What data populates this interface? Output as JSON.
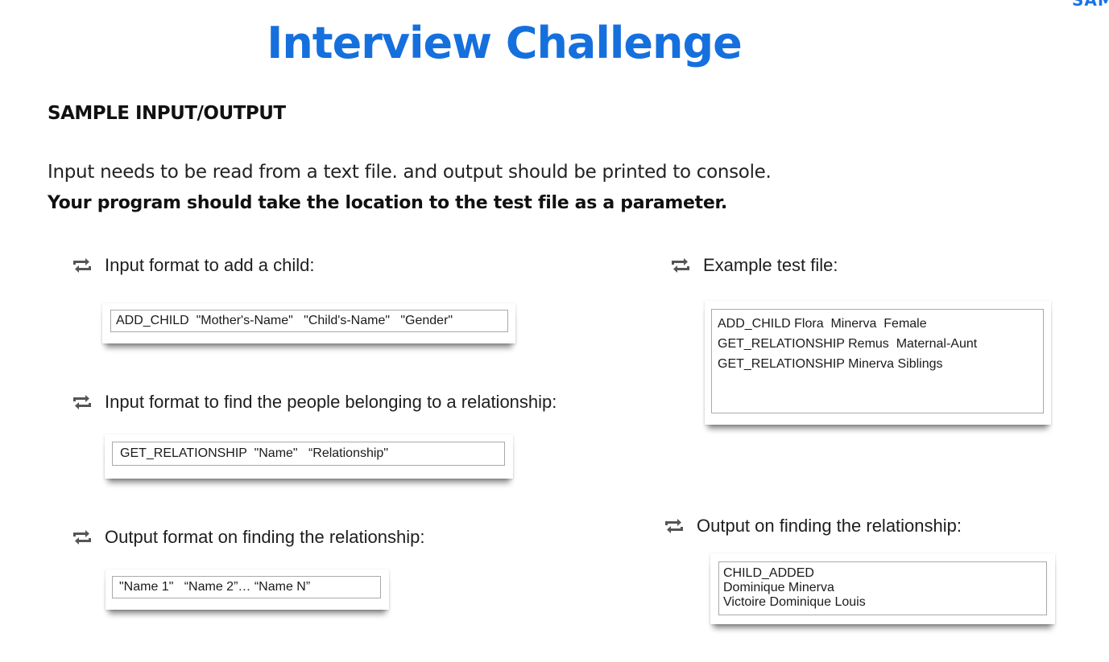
{
  "page": {
    "corner_mark": "SAMPLE",
    "title": "Interview Challenge",
    "section_heading": "SAMPLE INPUT/OUTPUT",
    "intro": "Input needs to be read from a text file. and output should be printed to console.",
    "intro_bold": "Your program should take the location to the test file as a parameter."
  },
  "icon": "retweet-icon",
  "left_blocks": [
    {
      "label": "Input format to add a child:",
      "code": [
        "ADD_CHILD  \"Mother's-Name\"   \"Child's-Name\"   \"Gender\""
      ]
    },
    {
      "label": "Input format to find the people belonging to a relationship:",
      "code": [
        "GET_RELATIONSHIP  \"Name\"   “Relationship\""
      ]
    },
    {
      "label": "Output format on finding the relationship:",
      "code": [
        "\"Name 1\"   “Name 2”… “Name N”"
      ]
    }
  ],
  "right_blocks": [
    {
      "label": "Example test file:",
      "code": [
        "ADD_CHILD Flora  Minerva  Female",
        "GET_RELATIONSHIP Remus  Maternal-Aunt",
        "GET_RELATIONSHIP Minerva Siblings"
      ]
    },
    {
      "label": "Output on finding the relationship:",
      "code": [
        "CHILD_ADDED",
        "Dominique Minerva",
        "Victoire Dominique Louis"
      ]
    }
  ],
  "colors": {
    "title": "#1570dd",
    "text": "#1a1a1a",
    "border": "#a9a9a9"
  }
}
